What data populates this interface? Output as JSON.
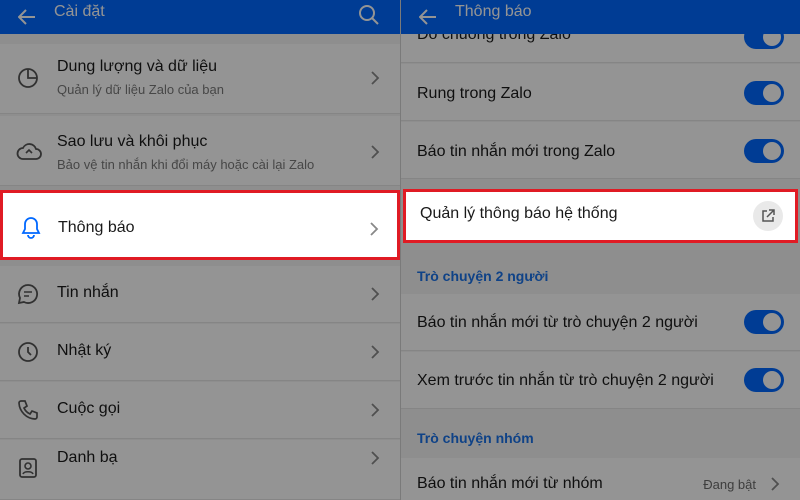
{
  "left": {
    "header_title": "Cài đặt",
    "items": [
      {
        "title": "Dung lượng và dữ liệu",
        "subtitle": "Quản lý dữ liệu Zalo của bạn",
        "icon": "pie-chart-icon"
      },
      {
        "title": "Sao lưu và khôi phục",
        "subtitle": "Bảo vệ tin nhắn khi đổi máy hoặc cài lại Zalo",
        "icon": "cloud-sync-icon"
      },
      {
        "title": "Thông báo",
        "subtitle": "",
        "icon": "bell-icon"
      },
      {
        "title": "Tin nhắn",
        "subtitle": "",
        "icon": "chat-bubble-icon"
      },
      {
        "title": "Nhật ký",
        "subtitle": "",
        "icon": "clock-icon"
      },
      {
        "title": "Cuộc gọi",
        "subtitle": "",
        "icon": "phone-icon"
      },
      {
        "title": "Danh bạ",
        "subtitle": "",
        "icon": "contacts-icon"
      }
    ]
  },
  "right": {
    "header_title": "Thông báo",
    "rows": [
      {
        "title": "Đổ chuông trong Zalo"
      },
      {
        "title": "Rung trong Zalo"
      },
      {
        "title": "Báo tin nhắn mới trong Zalo"
      }
    ],
    "system_row": {
      "title": "Quản lý thông báo hệ thống"
    },
    "section1": "Trò chuyện 2 người",
    "rows2": [
      {
        "title": "Báo tin nhắn mới từ trò chuyện 2 người"
      },
      {
        "title": "Xem trước tin nhắn từ trò chuyện 2 người"
      }
    ],
    "section2": "Trò chuyện nhóm",
    "group_row": {
      "title": "Báo tin nhắn mới từ nhóm",
      "status": "Đang bật"
    }
  },
  "colors": {
    "accent": "#0068ff",
    "highlight": "#e01b24",
    "section": "#1a73e8"
  }
}
